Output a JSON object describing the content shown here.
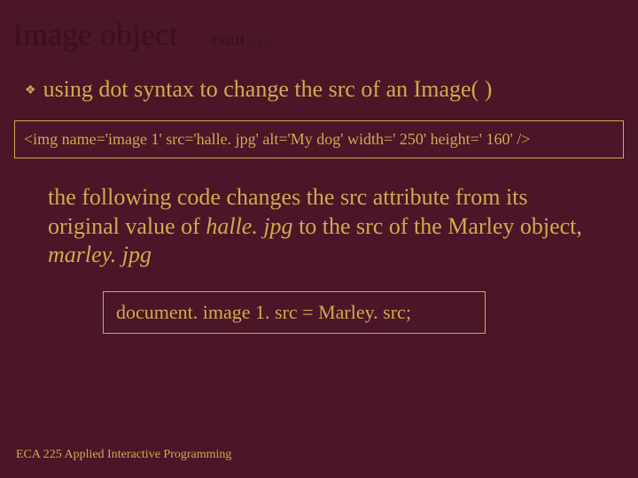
{
  "title": "Image object",
  "cont": "cont …",
  "bullet": "using dot syntax to change the src of an Image( )",
  "code1": "<img  name='image 1' src='halle. jpg'  alt='My dog'  width=' 250' height=' 160' />",
  "para_part1": "the following code changes the src attribute from its original value of  ",
  "para_italic1": "halle. jpg",
  "para_part2": " to the src of the Marley object, ",
  "para_italic2": "marley. jpg",
  "code2": "document. image 1. src = Marley. src;",
  "footer": "ECA 225   Applied Interactive Programming"
}
